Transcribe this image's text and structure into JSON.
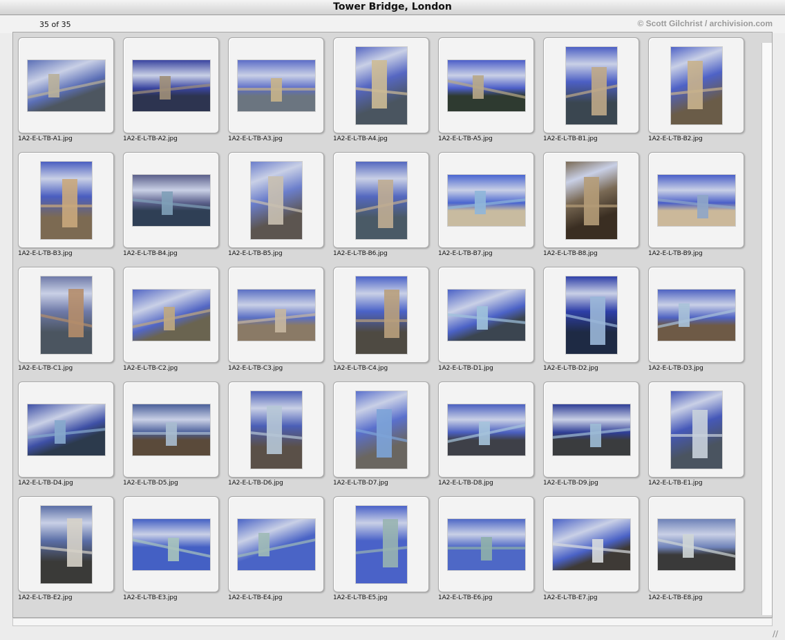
{
  "window": {
    "title": "Tower Bridge, London"
  },
  "header": {
    "count": "35 of 35",
    "copyright": "© Scott Gilchrist / archivision.com"
  },
  "items": [
    {
      "file": "1A2-E-L-TB-A1.jpg",
      "orientation": "land",
      "sky": "#5b6fb6",
      "ground": "#4d5660",
      "accent": "#b9b09a"
    },
    {
      "file": "1A2-E-L-TB-A2.jpg",
      "orientation": "land",
      "sky": "#3a45a0",
      "ground": "#2d3450",
      "accent": "#a08f78"
    },
    {
      "file": "1A2-E-L-TB-A3.jpg",
      "orientation": "land",
      "sky": "#5c6dc7",
      "ground": "#6b7580",
      "accent": "#c8b48a"
    },
    {
      "file": "1A2-E-L-TB-A4.jpg",
      "orientation": "port",
      "sky": "#5667c2",
      "ground": "#4a5560",
      "accent": "#cdbb95"
    },
    {
      "file": "1A2-E-L-TB-A5.jpg",
      "orientation": "land",
      "sky": "#4c5ec8",
      "ground": "#2e3a30",
      "accent": "#b8a988"
    },
    {
      "file": "1A2-E-L-TB-B1.jpg",
      "orientation": "port",
      "sky": "#4c5fc4",
      "ground": "#3a4650",
      "accent": "#bfa987"
    },
    {
      "file": "1A2-E-L-TB-B2.jpg",
      "orientation": "port",
      "sky": "#4e62c6",
      "ground": "#6a5c48",
      "accent": "#c9b28c"
    },
    {
      "file": "1A2-E-L-TB-B3.jpg",
      "orientation": "port",
      "sky": "#4a5ec0",
      "ground": "#7c6a52",
      "accent": "#caa97c"
    },
    {
      "file": "1A2-E-L-TB-B4.jpg",
      "orientation": "land",
      "sky": "#5a5f8a",
      "ground": "#2f3f55",
      "accent": "#7fa0b8"
    },
    {
      "file": "1A2-E-L-TB-B5.jpg",
      "orientation": "port",
      "sky": "#6b7ecb",
      "ground": "#5c5550",
      "accent": "#c9c0b0"
    },
    {
      "file": "1A2-E-L-TB-B6.jpg",
      "orientation": "port",
      "sky": "#5468bf",
      "ground": "#4a5a66",
      "accent": "#c0ad92"
    },
    {
      "file": "1A2-E-L-TB-B7.jpg",
      "orientation": "land",
      "sky": "#4a66d0",
      "ground": "#c8bba0",
      "accent": "#8fb6d9"
    },
    {
      "file": "1A2-E-L-TB-B8.jpg",
      "orientation": "port",
      "sky": "#7a6a55",
      "ground": "#3a2e22",
      "accent": "#b59c78"
    },
    {
      "file": "1A2-E-L-TB-B9.jpg",
      "orientation": "land",
      "sky": "#4a5fc8",
      "ground": "#cbb89a",
      "accent": "#8fa6c8"
    },
    {
      "file": "1A2-E-L-TB-C1.jpg",
      "orientation": "port",
      "sky": "#6f7aa8",
      "ground": "#4b5560",
      "accent": "#b58d6a"
    },
    {
      "file": "1A2-E-L-TB-C2.jpg",
      "orientation": "land",
      "sky": "#5266c4",
      "ground": "#6a6450",
      "accent": "#c0a880"
    },
    {
      "file": "1A2-E-L-TB-C3.jpg",
      "orientation": "land",
      "sky": "#5b70c4",
      "ground": "#8a7a66",
      "accent": "#c7b7a0"
    },
    {
      "file": "1A2-E-L-TB-C4.jpg",
      "orientation": "port",
      "sky": "#4b63c8",
      "ground": "#4e4a42",
      "accent": "#b9a07c"
    },
    {
      "file": "1A2-E-L-TB-D1.jpg",
      "orientation": "land",
      "sky": "#4b62c6",
      "ground": "#3b4550",
      "accent": "#9fc2dc"
    },
    {
      "file": "1A2-E-L-TB-D2.jpg",
      "orientation": "port",
      "sky": "#2e3fa8",
      "ground": "#1e2a44",
      "accent": "#9ab7d8"
    },
    {
      "file": "1A2-E-L-TB-D3.jpg",
      "orientation": "land",
      "sky": "#4e63c2",
      "ground": "#6e5a46",
      "accent": "#a9c2d8"
    },
    {
      "file": "1A2-E-L-TB-D4.jpg",
      "orientation": "land",
      "sky": "#3e50a6",
      "ground": "#2c3a4c",
      "accent": "#86a9cc"
    },
    {
      "file": "1A2-E-L-TB-D5.jpg",
      "orientation": "land",
      "sky": "#4a5f9a",
      "ground": "#5a4a3a",
      "accent": "#a9bcd0"
    },
    {
      "file": "1A2-E-L-TB-D6.jpg",
      "orientation": "port",
      "sky": "#4b5fb6",
      "ground": "#5a5048",
      "accent": "#b6c6d6"
    },
    {
      "file": "1A2-E-L-TB-D7.jpg",
      "orientation": "port",
      "sky": "#5a70cc",
      "ground": "#6a6660",
      "accent": "#7da4d8"
    },
    {
      "file": "1A2-E-L-TB-D8.jpg",
      "orientation": "land",
      "sky": "#4a5fbf",
      "ground": "#3e4048",
      "accent": "#a6c4dc"
    },
    {
      "file": "1A2-E-L-TB-D9.jpg",
      "orientation": "land",
      "sky": "#2f3e96",
      "ground": "#3a3c3e",
      "accent": "#9fbcd6"
    },
    {
      "file": "1A2-E-L-TB-E1.jpg",
      "orientation": "port",
      "sky": "#4558b8",
      "ground": "#4a5460",
      "accent": "#c9d2dc"
    },
    {
      "file": "1A2-E-L-TB-E2.jpg",
      "orientation": "port",
      "sky": "#5a6ea6",
      "ground": "#3a3a38",
      "accent": "#d6d2c8"
    },
    {
      "file": "1A2-E-L-TB-E3.jpg",
      "orientation": "land",
      "sky": "#4460c4",
      "ground": "#4460c4",
      "accent": "#a9c4bc"
    },
    {
      "file": "1A2-E-L-TB-E4.jpg",
      "orientation": "land",
      "sky": "#4a64c6",
      "ground": "#4a64c6",
      "accent": "#9fbab6"
    },
    {
      "file": "1A2-E-L-TB-E5.jpg",
      "orientation": "port",
      "sky": "#4a62c8",
      "ground": "#4a62c8",
      "accent": "#98b4b0"
    },
    {
      "file": "1A2-E-L-TB-E6.jpg",
      "orientation": "land",
      "sky": "#4e68c6",
      "ground": "#4e68c6",
      "accent": "#8fb0aa"
    },
    {
      "file": "1A2-E-L-TB-E7.jpg",
      "orientation": "land",
      "sky": "#4a62c6",
      "ground": "#3e3a36",
      "accent": "#d8dcde"
    },
    {
      "file": "1A2-E-L-TB-E8.jpg",
      "orientation": "land",
      "sky": "#6e82b8",
      "ground": "#3a3a3a",
      "accent": "#cfd6d6"
    }
  ]
}
